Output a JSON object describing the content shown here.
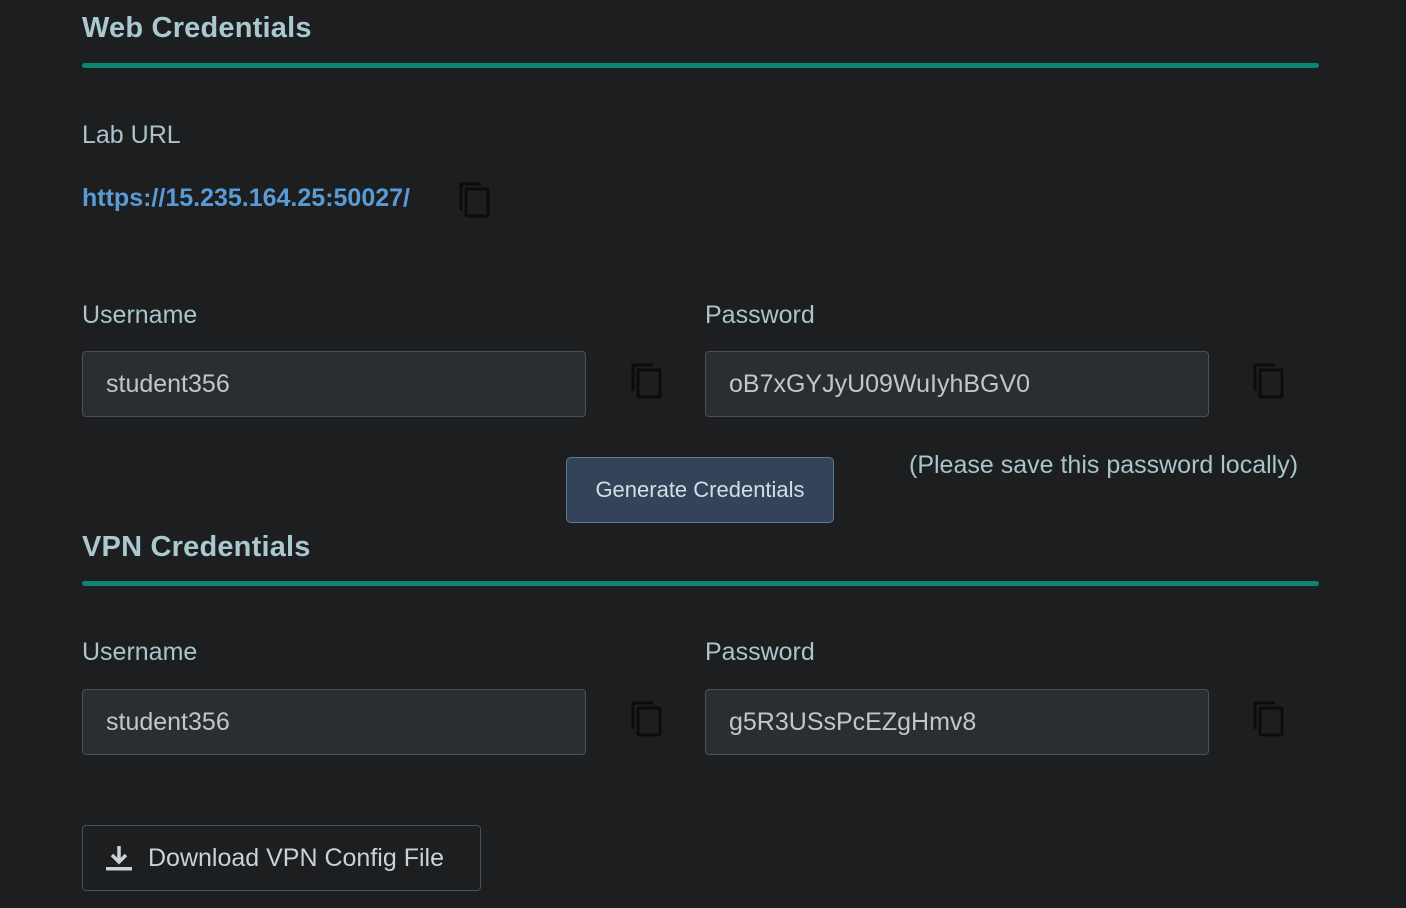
{
  "web": {
    "title": "Web Credentials",
    "lab_url_label": "Lab URL",
    "lab_url": "https://15.235.164.25:50027/",
    "username_label": "Username",
    "username": "student356",
    "password_label": "Password",
    "password": "oB7xGYJyU09WuIyhBGV0",
    "generate_button": "Generate Credentials",
    "note": "(Please save this password locally)"
  },
  "vpn": {
    "title": "VPN Credentials",
    "username_label": "Username",
    "username": "student356",
    "password_label": "Password",
    "password": "g5R3USsPcEZgHmv8",
    "download_button": "Download VPN Config File"
  },
  "icons": {
    "copy": "copy-icon",
    "download": "download-icon"
  },
  "colors": {
    "background": "#1c1e20",
    "accent_rule": "#0e8474",
    "link": "#5b9bd5",
    "heading": "#a9c9cf",
    "button_bg": "#33445a"
  }
}
